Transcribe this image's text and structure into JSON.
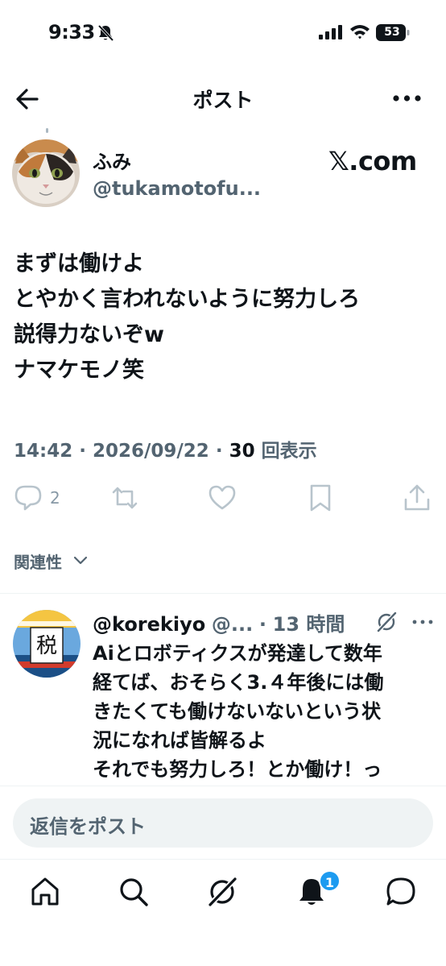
{
  "status_bar": {
    "time": "9:33",
    "battery": "53"
  },
  "header": {
    "title": "ポスト"
  },
  "post": {
    "author_name": "ふみ",
    "author_handle": "@tukamotofu...",
    "source_mark": "𝕏.com",
    "lines": [
      "まずは働けよ",
      "とやかく言われないように努力しろ",
      "説得力ないぞw",
      "ナマケモノ笑"
    ],
    "time": "14:42",
    "date": "2026/09/22",
    "views": "30",
    "views_label": "回表示",
    "reply_count": "2"
  },
  "related": {
    "label": "関連性"
  },
  "reply": {
    "name": "@korekiyo",
    "handle": "@...",
    "time": "13 時間",
    "avatar_char": "税",
    "lines": [
      "Aiとロボティクスが発達して数年",
      "経てば、おそらく3.４年後には働",
      "きたくても働けないないという状",
      "況になれば皆解るよ",
      "それでも努力しろ！とか働け！っ"
    ]
  },
  "compose": {
    "placeholder": "返信をポスト"
  },
  "nav": {
    "notifications_badge": "1"
  },
  "colors": {
    "accent": "#1d9bf0",
    "text": "#0f1419",
    "secondary": "#536471"
  }
}
